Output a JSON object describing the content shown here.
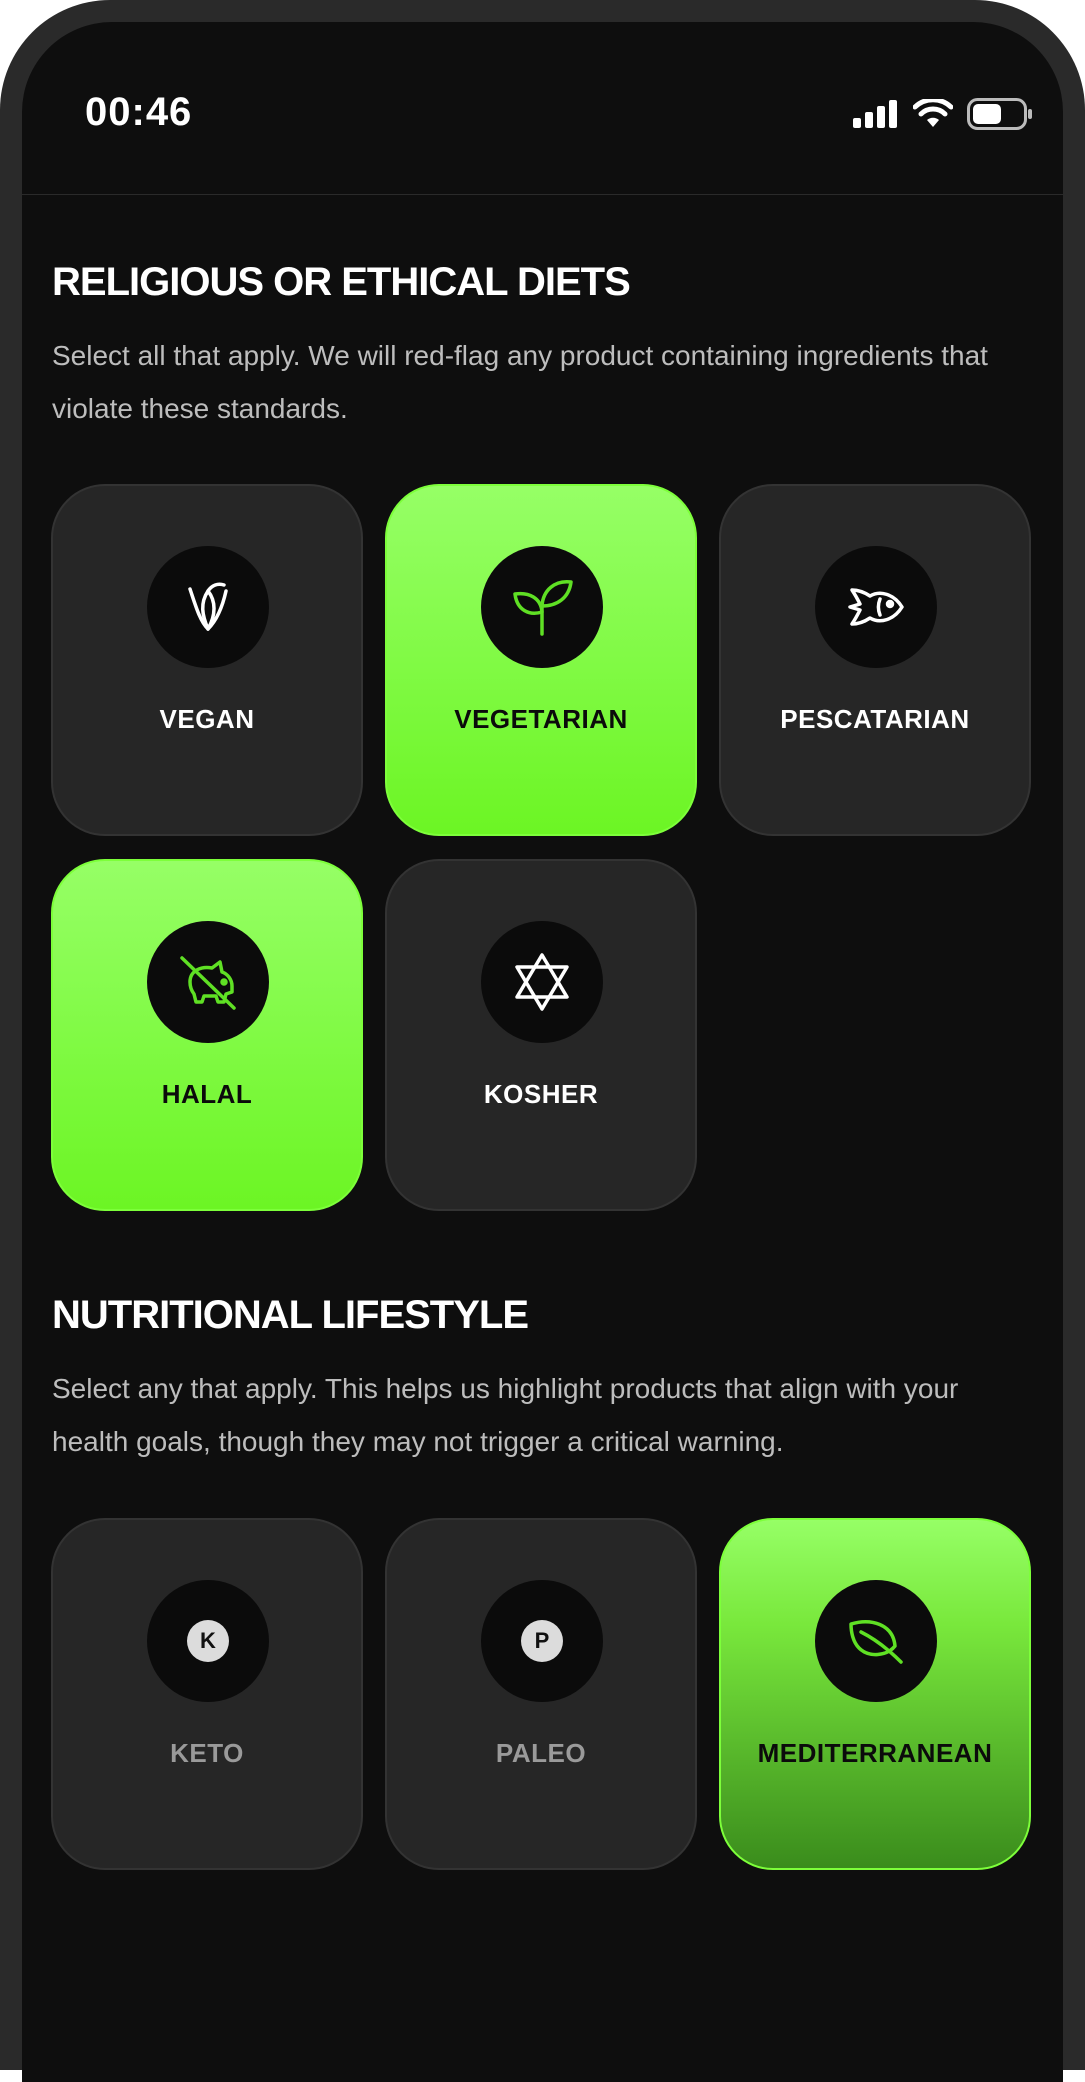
{
  "status_bar": {
    "time": "00:46"
  },
  "sections": [
    {
      "title": "RELIGIOUS OR ETHICAL DIETS",
      "description": "Select all that apply. We will red-flag any product containing ingredients that violate these standards.",
      "options": [
        {
          "label": "VEGAN",
          "icon": "vegan-v-leaf-icon",
          "selected": false
        },
        {
          "label": "VEGETARIAN",
          "icon": "sprout-icon",
          "selected": true
        },
        {
          "label": "PESCATARIAN",
          "icon": "fish-icon",
          "selected": false
        },
        {
          "label": "HALAL",
          "icon": "no-pork-icon",
          "selected": true
        },
        {
          "label": "KOSHER",
          "icon": "star-of-david-icon",
          "selected": false
        }
      ]
    },
    {
      "title": "NUTRITIONAL LIFESTYLE",
      "description": "Select any that apply. This helps us highlight products that align with your health goals, though they may not trigger a critical warning.",
      "options": [
        {
          "label": "KETO",
          "icon": "letter-k-icon",
          "badge": "K",
          "selected": false
        },
        {
          "label": "PALEO",
          "icon": "letter-p-icon",
          "badge": "P",
          "selected": false
        },
        {
          "label": "MEDITERRANEAN",
          "icon": "leaf-icon",
          "selected": true
        }
      ]
    }
  ],
  "colors": {
    "background": "#0e0e0e",
    "tile": "#262626",
    "accent_green": "#7dff3a",
    "icon_green": "#5fe024"
  }
}
